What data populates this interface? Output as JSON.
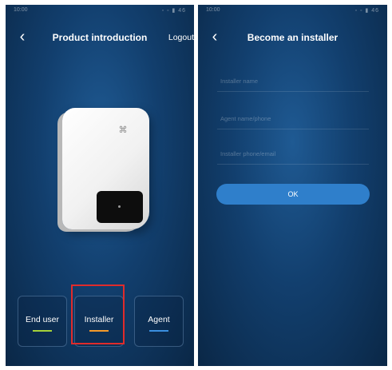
{
  "left_screen": {
    "status": {
      "time": "10:00",
      "icons": "◦ ◦ ▮ 46"
    },
    "title": "Product introduction",
    "logout": "Logout",
    "roles": [
      {
        "label": "End user",
        "color": "#a6d23a"
      },
      {
        "label": "Installer",
        "color": "#f39a2a"
      },
      {
        "label": "Agent",
        "color": "#3a8fe0"
      }
    ],
    "highlight_color": "#e02b2b"
  },
  "right_screen": {
    "status": {
      "time": "10:00",
      "icons": "◦ ◦ ▮ 46"
    },
    "title": "Become an installer",
    "fields": {
      "name_placeholder": "Installer name",
      "agent_placeholder": "Agent name/phone",
      "installer_placeholder": "Installer phone/email"
    },
    "ok_label": "OK"
  },
  "colors": {
    "accent": "#2f7fcb",
    "background": "#123f6e"
  }
}
